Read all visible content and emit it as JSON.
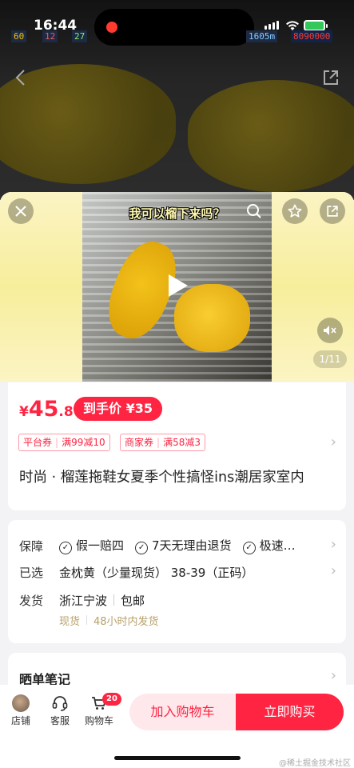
{
  "status": {
    "time": "16:44",
    "perf": {
      "fps": "60",
      "b": "12",
      "c": "27",
      "distance": "1605m",
      "id": "8090000"
    }
  },
  "icons": {
    "back": "chevron-left-icon",
    "share_top": "share-icon",
    "close": "close-icon",
    "search": "search-icon",
    "star": "star-icon",
    "share": "share-icon",
    "mute": "mute-icon",
    "play": "play-icon"
  },
  "video": {
    "caption": "我可以榴下来吗？",
    "counter": "1/11"
  },
  "price": {
    "currency": "¥",
    "integer": "45",
    "decimal": ".8",
    "deal_label": "到手价 ¥35"
  },
  "coupons": [
    {
      "type": "平台券",
      "text": "满99减10"
    },
    {
      "type": "商家券",
      "text": "满58减3"
    }
  ],
  "title": "时尚 · 榴莲拖鞋女夏季个性搞怪ins潮居家室内",
  "specs": {
    "guarantee_label": "保障",
    "guarantees": [
      "假一赔四",
      "7天无理由退货",
      "极速…"
    ],
    "selected_label": "已选",
    "selected_value": "金枕黄（少量现货） 38-39（正码）",
    "ship_label": "发货",
    "ship_from": "浙江宁波",
    "shipping": "包邮",
    "stock": "现货",
    "ship_time": "48小时内发货"
  },
  "notes": {
    "title": "晒单笔记"
  },
  "bottom": {
    "store": "店铺",
    "service": "客服",
    "cart": "购物车",
    "cart_count": "20",
    "add_to_cart": "加入购物车",
    "buy_now": "立即购买"
  },
  "watermark": "@稀土掘金技术社区",
  "colors": {
    "accent": "#ff2442",
    "accent_light": "#ffe8ec"
  }
}
